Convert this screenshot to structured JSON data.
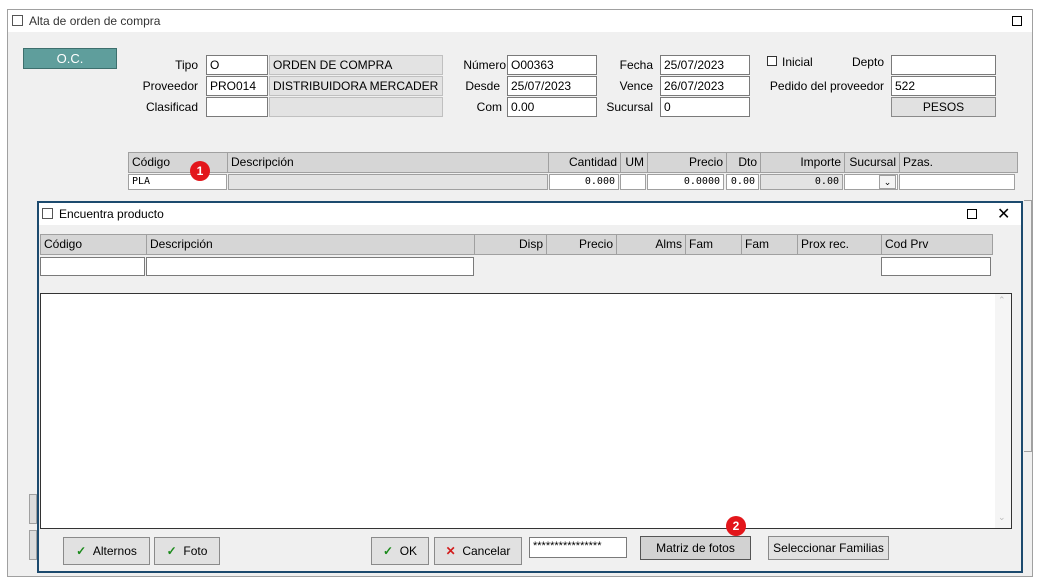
{
  "main_window": {
    "title": "Alta de orden de compra",
    "oc_button": "O.C.",
    "tipo": {
      "label": "Tipo",
      "code": "O",
      "desc": "ORDEN DE COMPRA"
    },
    "proveedor": {
      "label": "Proveedor",
      "code": "PRO014",
      "desc": "DISTRIBUIDORA MERCADER S.A."
    },
    "clasificad": {
      "label": "Clasificad",
      "code": "",
      "desc": ""
    },
    "numero": {
      "label": "Número",
      "value": "O00363"
    },
    "desde": {
      "label": "Desde",
      "value": "25/07/2023"
    },
    "com": {
      "label": "Com",
      "value": "0.00"
    },
    "fecha": {
      "label": "Fecha",
      "value": "25/07/2023"
    },
    "vence": {
      "label": "Vence",
      "value": "26/07/2023"
    },
    "sucursal": {
      "label": "Sucursal",
      "value": "0"
    },
    "inicial": {
      "label": "Inicial",
      "checked": false
    },
    "depto": {
      "label": "Depto",
      "value": ""
    },
    "pedido": {
      "label": "Pedido del proveedor",
      "value": "522"
    },
    "currency_button": "PESOS",
    "grid": {
      "headers": [
        "Código",
        "Descripción",
        "Cantidad",
        "UM",
        "Precio",
        "Dto",
        "Importe",
        "Sucursal",
        "Pzas."
      ],
      "row": {
        "codigo": "PLA",
        "descripcion": "",
        "cantidad": "0.000",
        "um": "",
        "precio": "0.0000",
        "dto": "0.00",
        "importe": "0.00",
        "sucursal": "",
        "pzas": ""
      }
    }
  },
  "dialog": {
    "title": "Encuentra producto",
    "headers": [
      "Código",
      "Descripción",
      "Disp",
      "Precio",
      "Alms",
      "Fam",
      "Fam",
      "Prox rec.",
      "Cod Prv"
    ],
    "filter": {
      "codigo": "",
      "descripcion": "",
      "cod_prv": ""
    },
    "buttons": {
      "alternos": "Alternos",
      "foto": "Foto",
      "ok": "OK",
      "cancelar": "Cancelar",
      "password": "****************",
      "matriz": "Matriz de fotos",
      "familias": "Seleccionar Familias"
    }
  },
  "badges": {
    "one": "1",
    "two": "2"
  },
  "colors": {
    "oc_button": "#5f9e9c",
    "dialog_border": "#1c4a6e",
    "badge": "#e3161b"
  }
}
